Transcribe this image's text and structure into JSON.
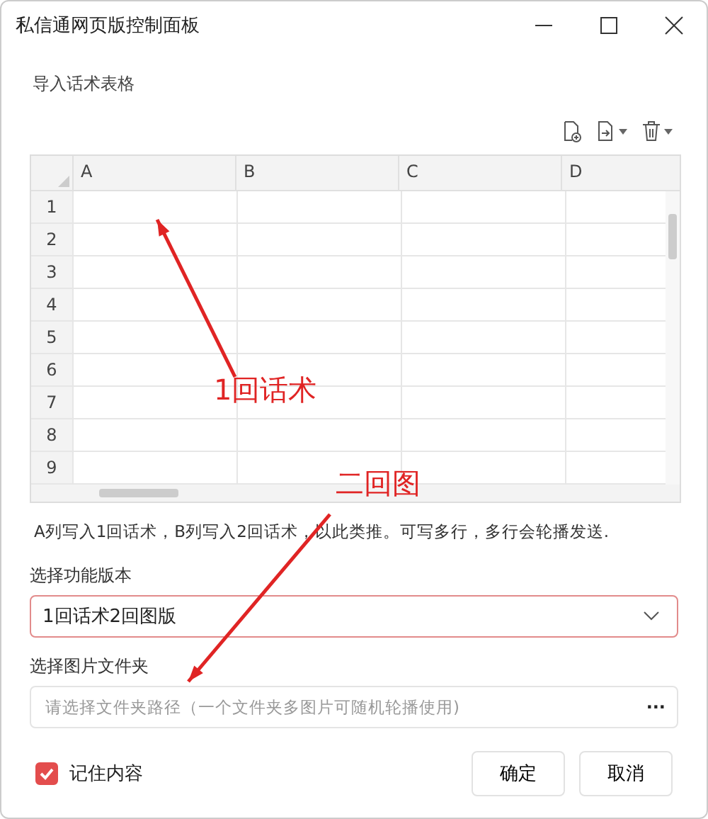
{
  "window": {
    "title": "私信通网页版控制面板",
    "controls": [
      {
        "kind": "minimize"
      },
      {
        "kind": "maximize"
      },
      {
        "kind": "close"
      }
    ]
  },
  "section_label": "导入话术表格",
  "toolbar": [
    {
      "kind": "add-file",
      "dropdown": false
    },
    {
      "kind": "import-file",
      "dropdown": true
    },
    {
      "kind": "delete",
      "dropdown": true
    }
  ],
  "sheet": {
    "columns": [
      "A",
      "B",
      "C",
      "D"
    ],
    "rows": [
      "1",
      "2",
      "3",
      "4",
      "5",
      "6",
      "7",
      "8",
      "9"
    ]
  },
  "hint": "A列写入1回话术，B列写入2回话术，以此类推。可写多行，多行会轮播发送.",
  "version": {
    "label": "选择功能版本",
    "value": "1回话术2回图版"
  },
  "folder": {
    "label": "选择图片文件夹",
    "placeholder": "请选择文件夹路径（一个文件夹多图片可随机轮播使用)",
    "browse": "···"
  },
  "remember": {
    "label": "记住内容",
    "checked": true
  },
  "buttons": [
    "确定",
    "取消"
  ],
  "annotations": [
    {
      "text": "1回话术",
      "kind": "up"
    },
    {
      "text": "二回图",
      "kind": "down"
    }
  ]
}
